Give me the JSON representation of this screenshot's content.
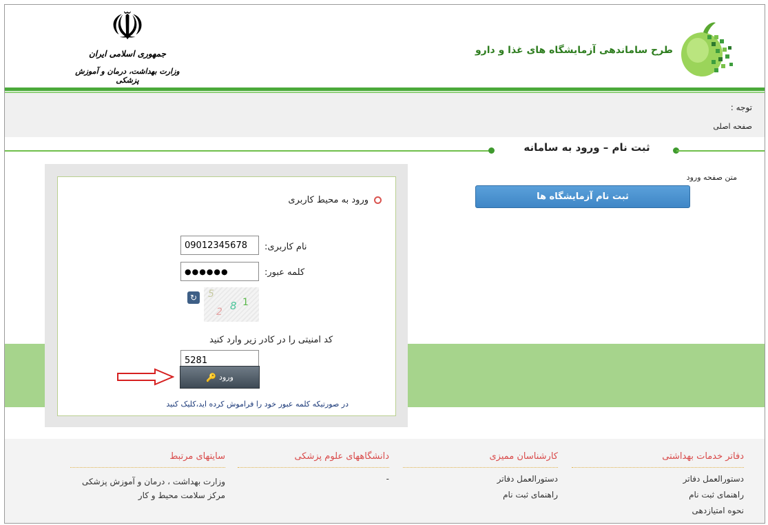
{
  "header": {
    "right_title": "طرح ساماندهی آزمایشگاه های غذا و دارو",
    "ministry_line1": "جمهوری اسلامی ایران",
    "ministry_line2": "وزارت بهداشت، درمان و آموزش پزشکی",
    "emblem_glyph": "☫"
  },
  "notice": {
    "label": "توجه :",
    "home_link": "صفحه اصلی"
  },
  "section_title": "ثبت نام – ورود به سامانه",
  "right_panel": {
    "intro_text": "متن صفحه ورود",
    "register_button": "ثبت نام آزمایشگاه ها"
  },
  "login": {
    "title": "ورود به محیط کاربری",
    "username_label": "نام کاربری:",
    "username_value": "09012345678",
    "password_label": "کلمه عبور:",
    "password_value": "●●●●●●",
    "captcha_digits": [
      "5",
      "2",
      "8",
      "1"
    ],
    "captcha_prompt": "کد امنیتی را در کادر زیر وارد کنید",
    "captcha_value": "5281",
    "submit_label": "ورود",
    "forgot_text": "در صورتیکه کلمه عبور خود را فراموش کرده اید،کلیک کنید"
  },
  "footer": {
    "columns": [
      {
        "title": "دفاتر خدمات بهداشتی",
        "links": [
          "دستورالعمل دفاتر",
          "راهنمای ثبت نام",
          "نحوه امتیازدهی"
        ]
      },
      {
        "title": "کارشناسان ممیزی",
        "links": [
          "دستورالعمل دفاتر",
          "راهنمای ثبت نام"
        ]
      },
      {
        "title": "دانشگاههای علوم پزشکی",
        "links": [
          "-"
        ]
      },
      {
        "title": "سایتهای مرتبط",
        "links": [
          "وزارت بهداشت ، درمان و آموزش پزشکی",
          "مرکز سلامت محیط و کار"
        ]
      }
    ]
  },
  "colors": {
    "brand_green": "#4aa93a",
    "band_green": "#a6d48c",
    "footer_title_red": "#d94a4a",
    "register_blue": "#3f86c6",
    "arrow_red": "#d62020"
  }
}
